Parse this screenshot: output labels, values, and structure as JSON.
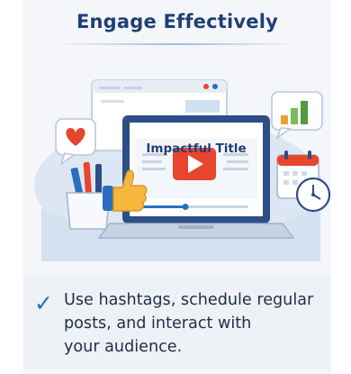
{
  "header": {
    "title": "Engage Effectively"
  },
  "illustration": {
    "video_title": "Impactful Title",
    "icons": [
      "heart-icon",
      "thumbs-up-icon",
      "bar-chart-icon",
      "calendar-icon",
      "clock-icon",
      "pen-cup-icon",
      "play-icon"
    ],
    "accent_color": "#e8452f",
    "brand_color": "#1f3f74"
  },
  "tip": {
    "lines": [
      "Use hashtags, schedule regular",
      "posts, and interact with",
      "your audience."
    ]
  }
}
